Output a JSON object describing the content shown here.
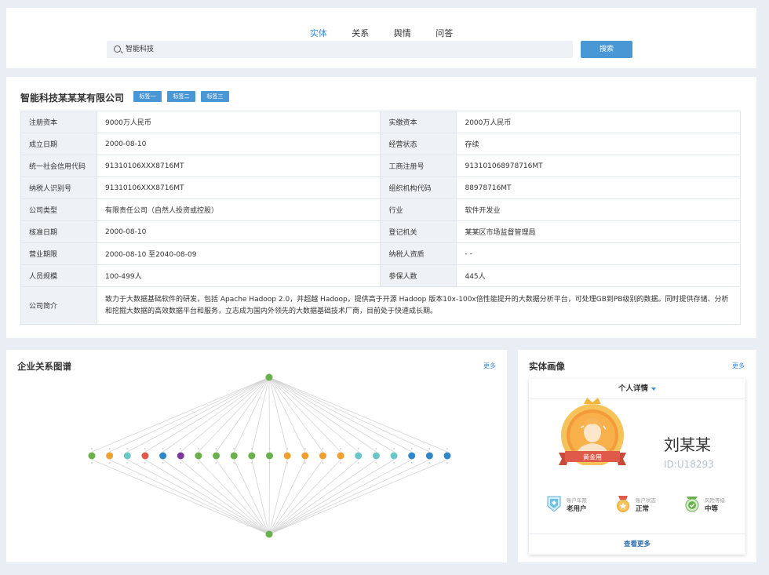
{
  "tabs": [
    "实体",
    "关系",
    "舆情",
    "问答"
  ],
  "search": {
    "value": "智能科技",
    "button": "搜索"
  },
  "company": {
    "name": "智能科技某某某有限公司",
    "tags": [
      "标签一",
      "标签二",
      "标签三"
    ],
    "rows": [
      [
        "注册资本",
        "9000万人民币",
        "实缴资本",
        "2000万人民币"
      ],
      [
        "成立日期",
        "2000-08-10",
        "经营状态",
        "存续"
      ],
      [
        "统一社会信用代码",
        "91310106XXX8716MT",
        "工商注册号",
        "913101068978716MT"
      ],
      [
        "纳税人识别号",
        "91310106XXX8716MT",
        "组织机构代码",
        "88978716MT"
      ],
      [
        "公司类型",
        "有限责任公司（自然人投资或控股）",
        "行业",
        "软件开发业"
      ],
      [
        "核准日期",
        "2000-08-10",
        "登记机关",
        "某某区市场监督管理局"
      ],
      [
        "营业期限",
        "2000-08-10 至2040-08-09",
        "纳税人资质",
        "- -"
      ],
      [
        "人员规模",
        "100-499人",
        "参保人数",
        "445人"
      ]
    ],
    "intro_label": "公司简介",
    "intro": "致力于大数据基础软件的研发，包括 Apache Hadoop 2.0，并超越 Hadoop，提供高于开源 Hadoop 版本10x-100x倍性能提升的大数据分析平台，可处理GB到PB级别的数据。同时提供存储、分析和挖掘大数据的高效数据平台和服务，立志成为国内外领先的大数据基础技术厂商，目前处于快速成长期。"
  },
  "graph": {
    "title": "企业关系图谱",
    "more": "更多",
    "top_color": "#6ab04c",
    "bottom_color": "#6ab04c",
    "nodes": [
      "#6ab04c",
      "#f0a030",
      "#6cc6c6",
      "#e05a4a",
      "#2f86c8",
      "#7a3a9a",
      "#6ab04c",
      "#6ab04c",
      "#6ab04c",
      "#6ab04c",
      "#6ab04c",
      "#f0a030",
      "#f0a030",
      "#f0a030",
      "#f0a030",
      "#6cc6c6",
      "#6cc6c6",
      "#6cc6c6",
      "#2f86c8",
      "#2f86c8",
      "#2f86c8"
    ]
  },
  "portrait": {
    "title": "实体画像",
    "more": "更多",
    "dropdown": "个人详情",
    "name": "刘某某",
    "id": "ID:U18293",
    "badge": "黄金用",
    "stats": [
      {
        "label": "账户年限",
        "value": "老用户",
        "icon": "account-age-icon"
      },
      {
        "label": "账户状态",
        "value": "正常",
        "icon": "account-status-icon"
      },
      {
        "label": "风险等级",
        "value": "中等",
        "icon": "risk-level-icon"
      }
    ],
    "footer": "查看更多"
  }
}
